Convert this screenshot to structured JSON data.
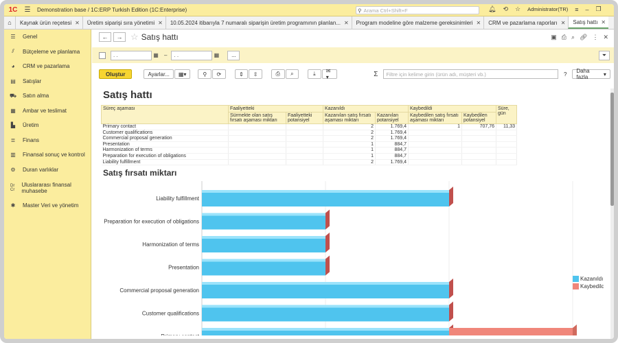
{
  "app": {
    "title": "Demonstration base / 1C:ERP Turkish Edition  (1C:Enterprise)",
    "search_placeholder": "Arama Ctrl+Shift+F",
    "user": "Administrator(TR)"
  },
  "tabs": [
    {
      "label": "Kaynak ürün reçetesi"
    },
    {
      "label": "Üretim siparişi sıra yönetimi"
    },
    {
      "label": "10.05.2024 itibarıyla 7 numaralı siparişin üretim programının planlan..."
    },
    {
      "label": "Program modeline göre malzeme gereksinimleri"
    },
    {
      "label": "CRM ve pazarlama raporları"
    },
    {
      "label": "Satış hattı"
    }
  ],
  "sidebar": {
    "items": [
      {
        "label": "Genel",
        "icon": "menu-icon"
      },
      {
        "label": "Bütçeleme ve planlama",
        "icon": "chart-icon"
      },
      {
        "label": "CRM ve pazarlama",
        "icon": "pie-icon"
      },
      {
        "label": "Satışlar",
        "icon": "bag-icon"
      },
      {
        "label": "Satın alma",
        "icon": "cart-icon"
      },
      {
        "label": "Ambar ve teslimat",
        "icon": "warehouse-icon"
      },
      {
        "label": "Üretim",
        "icon": "factory-icon"
      },
      {
        "label": "Finans",
        "icon": "coins-icon"
      },
      {
        "label": "Finansal sonuç ve kontrol",
        "icon": "bar-chart-icon"
      },
      {
        "label": "Duran varlıklar",
        "icon": "car-icon"
      },
      {
        "label": "Uluslararası finansal muhasebe",
        "icon": "dr-cr-icon"
      },
      {
        "label": "Master Veri ve yönetim",
        "icon": "gear-icon"
      }
    ]
  },
  "page": {
    "title": "Satış hattı",
    "date_from": ". .",
    "date_to": ". .",
    "dash": "–",
    "dots": "...",
    "create_button": "Oluştur",
    "settings_button": "Ayarlar...",
    "filter_placeholder": "Filtre için kelime girin (ürün adı, müşteri vb.)",
    "help": "?",
    "more_button": "Daha fazla"
  },
  "report": {
    "title": "Satış hattı",
    "headers": {
      "stage": "Süreç aşaması",
      "active": "Faaliyetteki",
      "active_qty": "Sürmekte olan satış fırsatı aşaması miktarı",
      "active_pot": "Faaliyetteki potansiyel",
      "won": "Kazanıldı",
      "won_qty": "Kazanılan satış fırsatı aşaması miktarı",
      "won_pot": "Kazanılan potansiyel",
      "lost": "Kaybedildi",
      "lost_qty": "Kaybedilen satış fırsatı aşaması miktarı",
      "lost_pot": "Kaybedilen potansiyel",
      "days": "Süre, gün"
    },
    "rows": [
      {
        "stage": "Primary contact",
        "won_qty": "2",
        "won_pot": "1.769,4",
        "lost_qty": "1",
        "lost_pot": "707,76",
        "days": "11,33"
      },
      {
        "stage": "Customer qualifications",
        "won_qty": "2",
        "won_pot": "1.769,4",
        "lost_qty": "",
        "lost_pot": "",
        "days": ""
      },
      {
        "stage": "Commercial proposal generation",
        "won_qty": "2",
        "won_pot": "1.769,4",
        "lost_qty": "",
        "lost_pot": "",
        "days": ""
      },
      {
        "stage": "Presentation",
        "won_qty": "1",
        "won_pot": "884,7",
        "lost_qty": "",
        "lost_pot": "",
        "days": ""
      },
      {
        "stage": "Harmonization of terms",
        "won_qty": "1",
        "won_pot": "884,7",
        "lost_qty": "",
        "lost_pot": "",
        "days": ""
      },
      {
        "stage": "Preparation for execution of obligations",
        "won_qty": "1",
        "won_pot": "884,7",
        "lost_qty": "",
        "lost_pot": "",
        "days": ""
      },
      {
        "stage": "Liability fulfillment",
        "won_qty": "2",
        "won_pot": "1.769,4",
        "lost_qty": "",
        "lost_pot": "",
        "days": ""
      }
    ],
    "chart_title": "Satış fırsatı miktarı"
  },
  "colors": {
    "won": "#4fc4ee",
    "lost": "#f0867a",
    "accent": "#f7d531"
  },
  "chart_data": {
    "type": "bar",
    "orientation": "horizontal",
    "stacked": true,
    "title": "Satış fırsatı miktarı",
    "categories": [
      "Liability fulfillment",
      "Preparation for execution of obligations",
      "Harmonization of terms",
      "Presentation",
      "Commercial proposal generation",
      "Customer qualifications",
      "Primary contact"
    ],
    "series": [
      {
        "name": "Kazanıldı",
        "values": [
          2,
          1,
          1,
          1,
          2,
          2,
          2
        ]
      },
      {
        "name": "Kaybedildi",
        "values": [
          0,
          0,
          0,
          0,
          0,
          0,
          1
        ]
      }
    ],
    "xlim": [
      0,
      3
    ],
    "legend": "right"
  }
}
